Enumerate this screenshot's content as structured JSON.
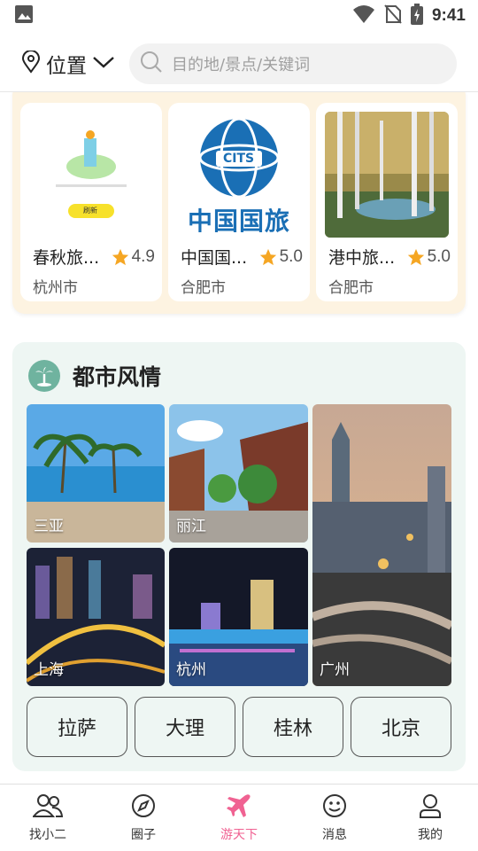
{
  "status": {
    "time": "9:41"
  },
  "header": {
    "location_label": "位置",
    "search_placeholder": "目的地/景点/关键词"
  },
  "hotels": [
    {
      "name": "春秋旅...",
      "rating": "4.9",
      "city": "杭州市",
      "image": "placeholder-illustration",
      "image_button": "刷新"
    },
    {
      "name": "中国国...",
      "rating": "5.0",
      "city": "合肥市",
      "image": "cits-logo",
      "logo_text": "中国国旅",
      "logo_abbr": "CITS"
    },
    {
      "name": "港中旅...",
      "rating": "5.0",
      "city": "合肥市",
      "image": "birch-forest-painting"
    }
  ],
  "city_section": {
    "title": "都市风情",
    "icon": "palm-tree-icon",
    "tiles": [
      {
        "label": "三亚"
      },
      {
        "label": "丽江"
      },
      {
        "label": "广州"
      },
      {
        "label": "上海"
      },
      {
        "label": "杭州"
      }
    ],
    "chips": [
      "拉萨",
      "大理",
      "桂林",
      "北京"
    ]
  },
  "nav": {
    "items": [
      {
        "label": "找小二",
        "icon": "people-icon"
      },
      {
        "label": "圈子",
        "icon": "compass-icon"
      },
      {
        "label": "游天下",
        "icon": "airplane-icon"
      },
      {
        "label": "消息",
        "icon": "smiley-icon"
      },
      {
        "label": "我的",
        "icon": "user-icon"
      }
    ],
    "active": "游天下",
    "active_color": "#f06292"
  },
  "colors": {
    "accent": "#f06292",
    "star": "#f5a623",
    "city_panel": "#eef6f3",
    "hotel_panel": "#fdf3e1"
  }
}
